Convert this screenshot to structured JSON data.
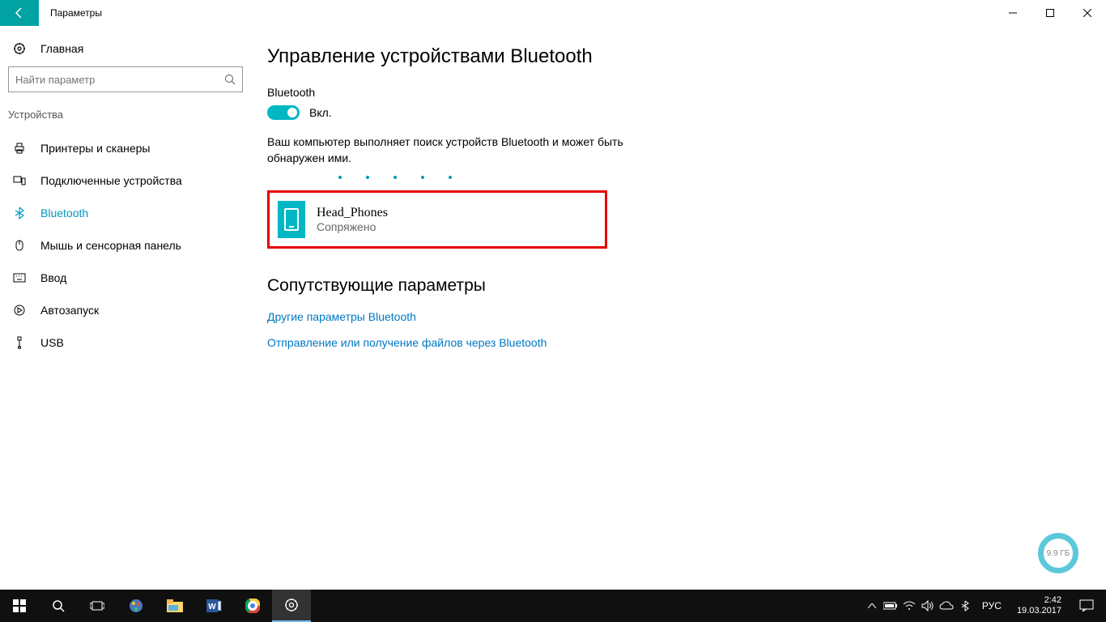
{
  "titlebar": {
    "title": "Параметры"
  },
  "sidebar": {
    "home": "Главная",
    "search_placeholder": "Найти параметр",
    "section": "Устройства",
    "items": [
      {
        "label": "Принтеры и сканеры"
      },
      {
        "label": "Подключенные устройства"
      },
      {
        "label": "Bluetooth"
      },
      {
        "label": "Мышь и сенсорная панель"
      },
      {
        "label": "Ввод"
      },
      {
        "label": "Автозапуск"
      },
      {
        "label": "USB"
      }
    ]
  },
  "main": {
    "title": "Управление устройствами Bluetooth",
    "toggle_section": "Bluetooth",
    "toggle_state": "Вкл.",
    "status": "Ваш компьютер выполняет поиск устройств Bluetooth и может быть обнаружен ими.",
    "device": {
      "name": "Head_Phones",
      "status": "Сопряжено"
    },
    "related_title": "Сопутствующие параметры",
    "links": [
      "Другие параметры Bluetooth",
      "Отправление или получение файлов через Bluetooth"
    ]
  },
  "overlay": {
    "circle": "9.9 ГБ"
  },
  "taskbar": {
    "lang": "РУС",
    "time": "2:42",
    "date": "19.03.2017"
  }
}
